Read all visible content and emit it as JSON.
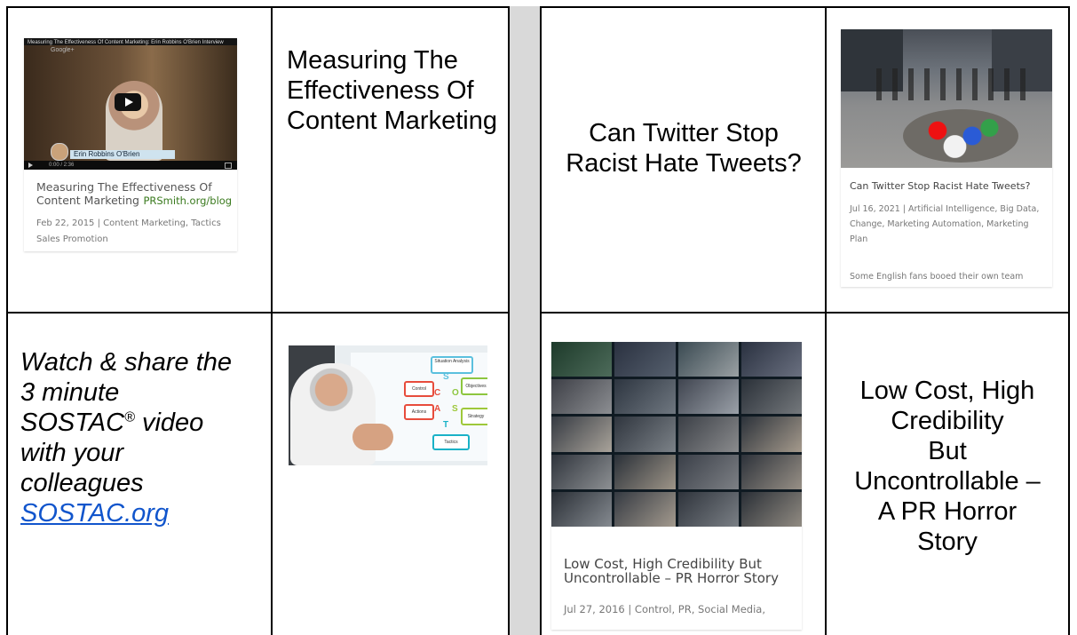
{
  "row1": {
    "video_thumb": {
      "video_title": "Measuring The Effectiveness Of Content Marketing: Erin Robbins O'Brien Interview",
      "channel": "Google+",
      "name_tag": "Erin Robbins O'Brien",
      "time": "0:00 / 2:36",
      "title_line1": "Measuring The Effectiveness Of",
      "title_line2": "Content Marketing",
      "watermark": "PRSmith.org/blog",
      "meta": "Feb 22, 2015 | Content Marketing, Tactics",
      "meta2": "Sales Promotion"
    },
    "title_cell": "Measuring The Effectiveness Of Content Marketing",
    "twitter_cell": "Can Twitter Stop Racist Hate Tweets?",
    "twitter_thumb": {
      "title": "Can Twitter Stop Racist Hate Tweets?",
      "meta": "Jul 16, 2021 | Artificial Intelligence, Big Data, Change, Marketing Automation, Marketing Plan",
      "excerpt": "Some English fans booed their own team"
    }
  },
  "row2": {
    "sostac_line1": "Watch & share the",
    "sostac_line2": "3 minute",
    "sostac_line3": "SOSTAC",
    "sostac_reg": "®",
    "sostac_line3b": " video",
    "sostac_line4": "with your",
    "sostac_line5": "colleagues",
    "sostac_link": "SOSTAC.org",
    "diagram_labels": [
      "Situation Analysis",
      "Objectives",
      "Strategy",
      "Tactics",
      "Actions",
      "Control"
    ],
    "diagram_letters": [
      "S",
      "O",
      "S",
      "T",
      "A",
      "C"
    ],
    "pr_thumb": {
      "title_line1": "Low Cost, High Credibility But",
      "title_line2": "Uncontrollable – PR Horror Story",
      "meta": "Jul 27, 2016 | Control, PR, Social Media,"
    },
    "pr_cell_line1": "Low Cost, High",
    "pr_cell_line2": "Credibility",
    "pr_cell_line3": "But",
    "pr_cell_line4": "Uncontrollable –",
    "pr_cell_line5": "A PR Horror",
    "pr_cell_line6": "Story"
  },
  "colors": {
    "link": "#1155cc",
    "separator": "#d9d9d9",
    "watermark": "#3a7a1e"
  }
}
